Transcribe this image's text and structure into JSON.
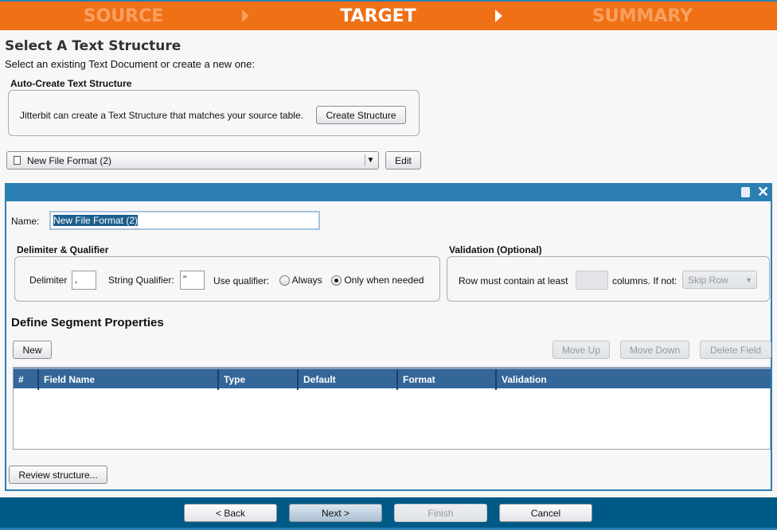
{
  "wizard": {
    "steps": [
      {
        "label": "SOURCE",
        "active": false
      },
      {
        "label": "TARGET",
        "active": true
      },
      {
        "label": "SUMMARY",
        "active": false
      }
    ]
  },
  "page": {
    "title": "Select A Text Structure",
    "subtitle": "Select an existing Text Document or create a new one:"
  },
  "auto_create": {
    "heading": "Auto-Create Text Structure",
    "description": "Jitterbit can create a Text Structure that matches your source table.",
    "button": "Create Structure"
  },
  "structure_select": {
    "value": "New File Format (2)",
    "icon": "document-icon",
    "edit_label": "Edit"
  },
  "panel": {
    "name_label": "Name:",
    "name_value": "New File Format (2)",
    "delimiter": {
      "heading": "Delimiter & Qualifier",
      "delimiter_label": "Delimiter",
      "delimiter_value": ",",
      "qualifier_label": "String Qualifier:",
      "qualifier_value": "\"",
      "use_label": "Use qualifier:",
      "options": [
        {
          "label": "Always",
          "selected": false
        },
        {
          "label": "Only when needed",
          "selected": true
        }
      ]
    },
    "validation": {
      "heading": "Validation (Optional)",
      "row_label": "Row must contain at least",
      "columns_value": "",
      "columns_label": "columns. If not:",
      "if_not_value": "Skip Row"
    },
    "segment_heading": "Define Segment Properties",
    "new_label": "New",
    "move_up": "Move Up",
    "move_down": "Move Down",
    "delete_field": "Delete Field",
    "columns": [
      "#",
      "Field Name",
      "Type",
      "Default",
      "Format",
      "Validation"
    ],
    "rows": [],
    "review_label": "Review structure..."
  },
  "footer": {
    "back": "< Back",
    "next": "Next >",
    "finish": "Finish",
    "cancel": "Cancel"
  }
}
